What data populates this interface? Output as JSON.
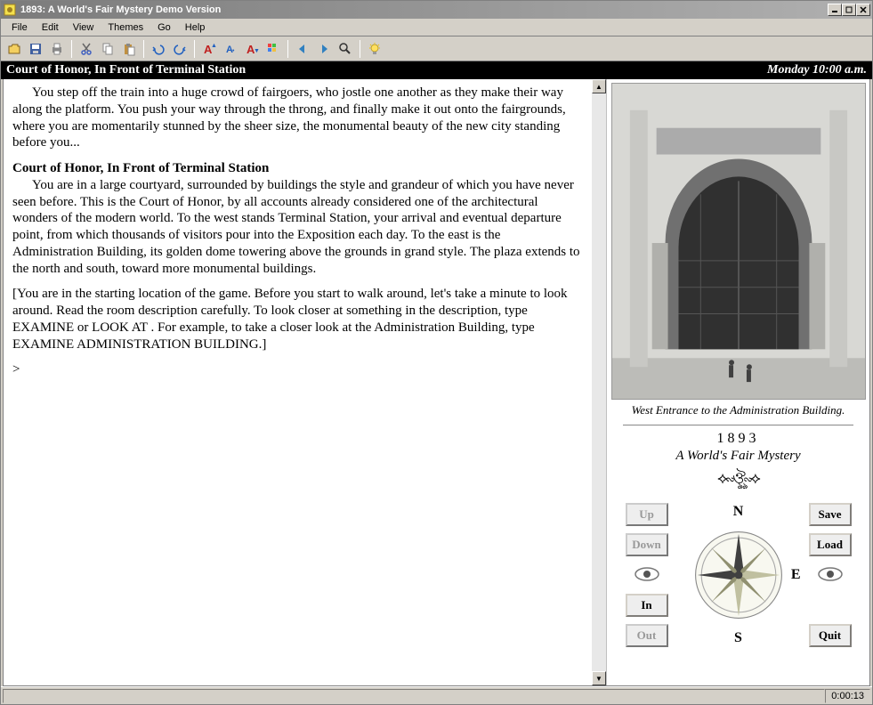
{
  "window": {
    "title": "1893: A World's Fair Mystery Demo Version"
  },
  "menu": {
    "items": [
      "File",
      "Edit",
      "View",
      "Themes",
      "Go",
      "Help"
    ]
  },
  "toolbar": {
    "icons": [
      "open-icon",
      "save-icon",
      "print-icon",
      "cut-icon",
      "copy-icon",
      "paste-icon",
      "undo-icon",
      "redo-icon",
      "font-larger-icon",
      "font-normal-icon",
      "font-smaller-icon",
      "color-icon",
      "back-icon",
      "forward-icon",
      "search-icon",
      "bulb-icon"
    ]
  },
  "locbar": {
    "location": "Court of Honor, In Front of Terminal Station",
    "time": "Monday 10:00 a.m."
  },
  "story": {
    "intro": "You step off the train into a huge crowd of fairgoers, who jostle one another as they make their way along the platform. You push your way through the throng, and finally make it out onto the fairgrounds, where you are momentarily stunned by the sheer size, the monumental beauty of the new city standing before you...",
    "heading": "Court of Honor, In Front of Terminal Station",
    "body": "You are in a large courtyard, surrounded by buildings the style and grandeur of which you have never seen before. This is the Court of Honor, by all accounts already considered one of the architectural wonders of the modern world. To the west stands Terminal Station, your arrival and eventual departure point, from which thousands of visitors pour into the Exposition each day. To the east is the Administration Building, its golden dome towering above the grounds in grand style. The plaza extends to the north and south, toward more monumental buildings.",
    "hint": "[You are in the starting location of the game. Before you start to walk around, let's take a minute to look around. Read the room description carefully. To look closer at something in the description, type EXAMINE or LOOK AT . For example, to take a closer look at the Administration Building, type EXAMINE ADMINISTRATION BUILDING.]",
    "prompt": ">"
  },
  "sidepane": {
    "caption": "West Entrance to the Administration Building.",
    "year": "1893",
    "subtitle": "A World's Fair Mystery"
  },
  "nav": {
    "up": "Up",
    "down": "Down",
    "in": "In",
    "out": "Out",
    "save": "Save",
    "load": "Load",
    "quit": "Quit",
    "n": "N",
    "s": "S",
    "e": "E"
  },
  "status": {
    "timer": "0:00:13"
  }
}
